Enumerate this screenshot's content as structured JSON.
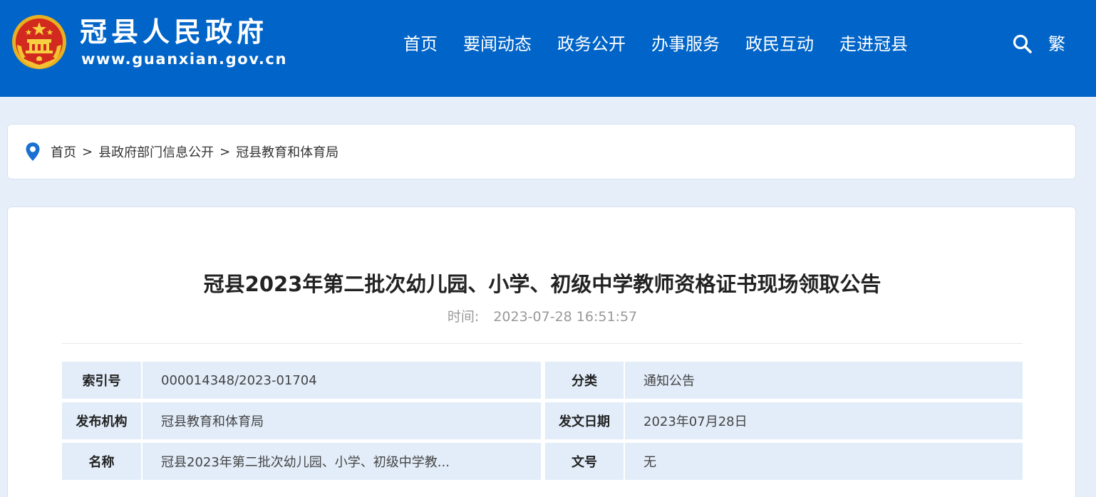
{
  "header": {
    "site_name": "冠县人民政府",
    "site_url": "www.guanxian.gov.cn",
    "nav": [
      "首页",
      "要闻动态",
      "政务公开",
      "办事服务",
      "政民互动",
      "走进冠县"
    ],
    "traditional_label": "繁",
    "bg_color": "#0064c8"
  },
  "breadcrumb": {
    "items": [
      "首页",
      "县政府部门信息公开",
      "冠县教育和体育局"
    ],
    "separator": ">"
  },
  "article": {
    "title": "冠县2023年第二批次幼儿园、小学、初级中学教师资格证书现场领取公告",
    "time_label": "时间:",
    "time_value": "2023-07-28 16:51:57"
  },
  "info": {
    "rows": [
      {
        "label1": "索引号",
        "value1": "000014348/2023-01704",
        "label2": "分类",
        "value2": "通知公告"
      },
      {
        "label1": "发布机构",
        "value1": "冠县教育和体育局",
        "label2": "发文日期",
        "value2": "2023年07月28日"
      },
      {
        "label1": "名称",
        "value1": "冠县2023年第二批次幼儿园、小学、初级中学教...",
        "label2": "文号",
        "value2": "无"
      }
    ]
  },
  "icons": {
    "emblem": "national-emblem-icon",
    "search": "search-icon",
    "location": "location-pin-icon"
  }
}
